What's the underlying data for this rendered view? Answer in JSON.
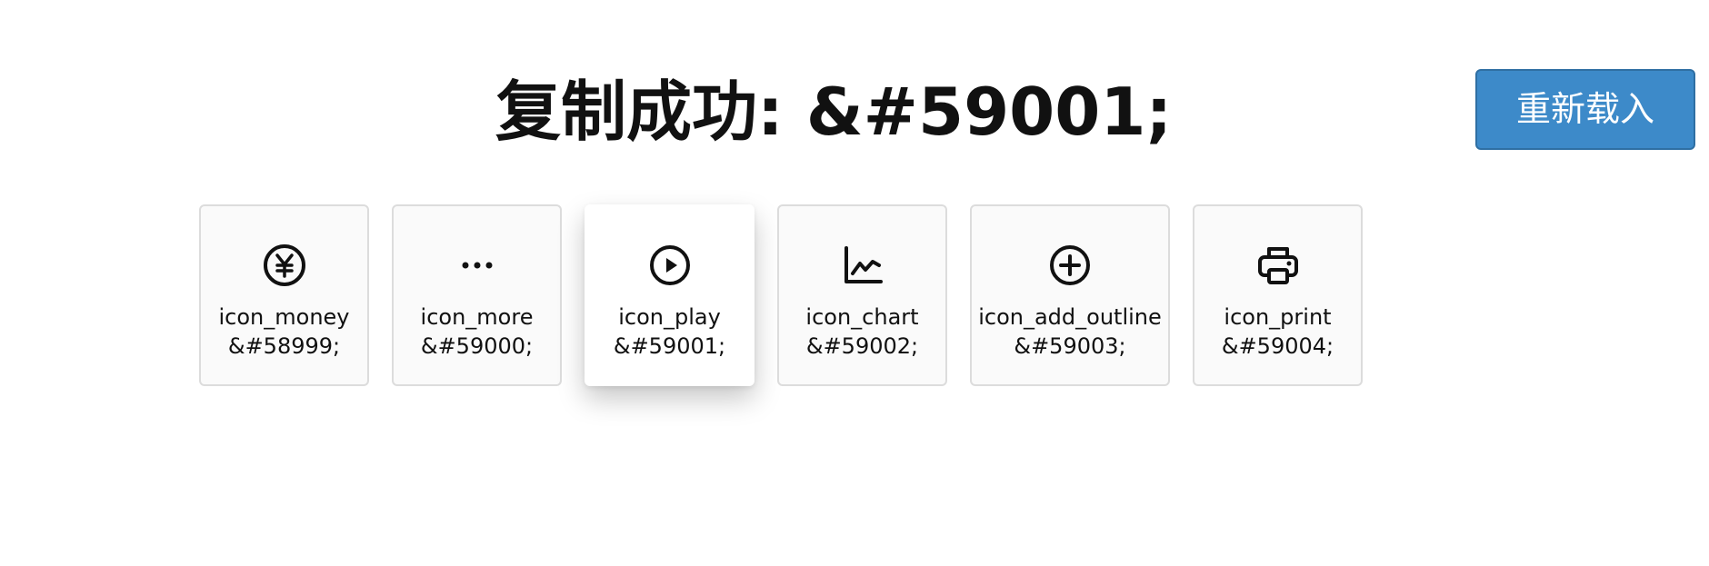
{
  "title": "复制成功: &#59001;",
  "reload_button": "重新载入",
  "icons": [
    {
      "name": "icon_money",
      "code": "&#58999;",
      "icon": "money-icon"
    },
    {
      "name": "icon_more",
      "code": "&#59000;",
      "icon": "more-icon"
    },
    {
      "name": "icon_play",
      "code": "&#59001;",
      "icon": "play-icon",
      "selected": true
    },
    {
      "name": "icon_chart",
      "code": "&#59002;",
      "icon": "chart-icon"
    },
    {
      "name": "icon_add_outline",
      "code": "&#59003;",
      "icon": "add-outline-icon"
    },
    {
      "name": "icon_print",
      "code": "&#59004;",
      "icon": "print-icon"
    }
  ]
}
